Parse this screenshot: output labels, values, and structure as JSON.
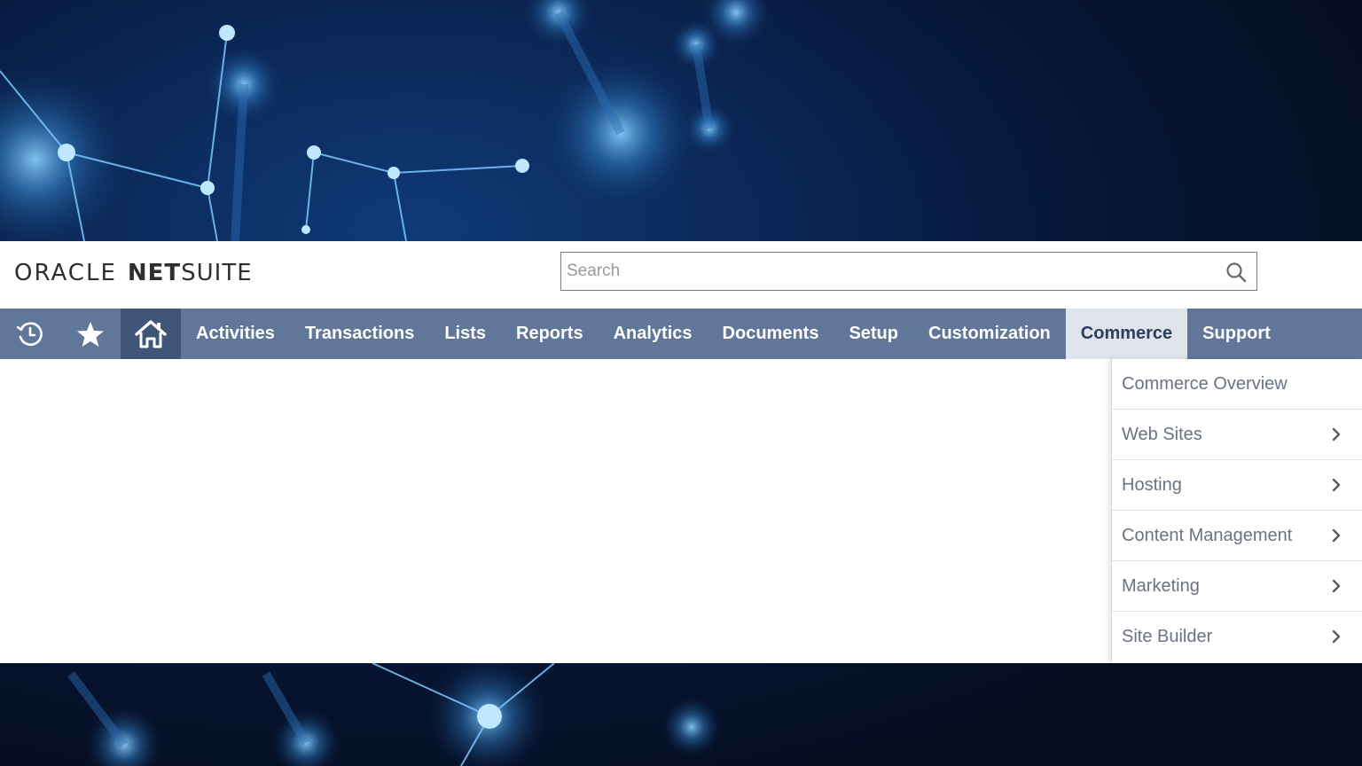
{
  "brand": {
    "oracle": "ORACLE",
    "net": "NET",
    "suite": "SUITE"
  },
  "search": {
    "placeholder": "Search",
    "value": ""
  },
  "nav": {
    "icons": [
      "recent-records-icon",
      "favorites-star-icon",
      "home-icon"
    ],
    "items": [
      {
        "label": "Activities"
      },
      {
        "label": "Transactions"
      },
      {
        "label": "Lists"
      },
      {
        "label": "Reports"
      },
      {
        "label": "Analytics"
      },
      {
        "label": "Documents"
      },
      {
        "label": "Setup"
      },
      {
        "label": "Customization"
      },
      {
        "label": "Commerce",
        "active": true
      },
      {
        "label": "Support"
      }
    ]
  },
  "commerce_menu": {
    "items": [
      {
        "label": "Commerce Overview",
        "submenu": false
      },
      {
        "label": "Web Sites",
        "submenu": true
      },
      {
        "label": "Hosting",
        "submenu": true
      },
      {
        "label": "Content Management",
        "submenu": true
      },
      {
        "label": "Marketing",
        "submenu": true
      },
      {
        "label": "Site Builder",
        "submenu": true
      }
    ]
  },
  "colors": {
    "nav_bg": "#607799",
    "nav_home_bg": "#3f5577",
    "nav_active_bg": "#dfe4ec",
    "menu_text": "#6b7380"
  }
}
